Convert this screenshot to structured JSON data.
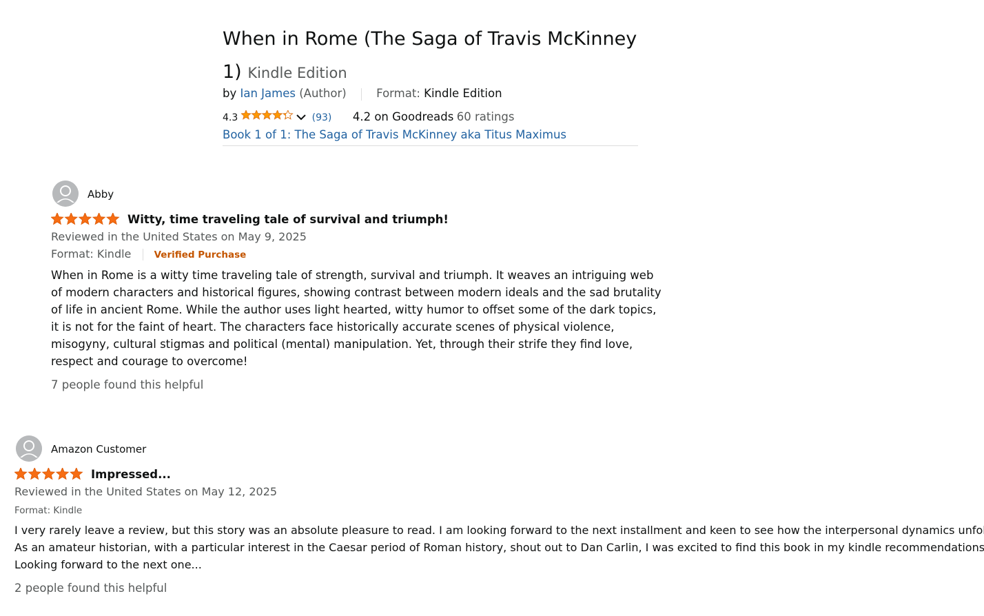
{
  "product": {
    "title_line1": "When in Rome (The Saga of Travis McKinney",
    "title_line2": "1)",
    "edition": "Kindle Edition",
    "by": "by",
    "author": "Ian James",
    "author_role": "(Author)",
    "format_label": "Format:",
    "format_value": "Kindle Edition",
    "rating_value": "4.3",
    "rating_stars": 4.3,
    "rating_count": "(93)",
    "goodreads_rating": "4.2 on Goodreads",
    "goodreads_count": "60 ratings",
    "series_link": "Book 1 of 1: The Saga of Travis McKinney aka Titus Maximus"
  },
  "colors": {
    "star": "#ff9900",
    "star_review": "#f76d13",
    "link": "#2162a1",
    "verified": "#c45500",
    "muted": "#565959"
  },
  "reviews": [
    {
      "reviewer": "Abby",
      "stars": 5,
      "title": "Witty, time traveling tale of survival and triumph!",
      "meta": "Reviewed in the United States on May 9, 2025",
      "format": "Format: Kindle",
      "verified": "Verified Purchase",
      "body_lines": [
        "When in Rome is a witty time traveling tale of strength, survival and triumph. It weaves an intriguing web",
        "of modern characters and historical figures, showing contrast between modern ideals and the sad brutality",
        "of life in ancient Rome. While the author uses light hearted, witty humor to offset some of the dark topics,",
        "it is not for the faint of heart. The characters face historically accurate scenes of physical violence,",
        "misogyny, cultural stigmas and political (mental) manipulation. Yet, through their strife they find love,",
        "respect and courage to overcome!"
      ],
      "helpful": "7 people found this helpful"
    },
    {
      "reviewer": "Amazon Customer",
      "stars": 5,
      "title": "Impressed...",
      "meta": "Reviewed in the United States on May 12, 2025",
      "format": "Format: Kindle",
      "body_lines": [
        "I very rarely leave a review, but this story was an absolute pleasure to read. I am looking forward to the next installment and keen to see how the interpersonal dynamics unfold.",
        "As an amateur historian, with a particular interest in the Caesar period of Roman history, shout out to Dan Carlin, I was excited to find this book in my kindle recommendations.",
        "Looking forward to the next one..."
      ],
      "helpful": "2 people found this helpful"
    }
  ]
}
